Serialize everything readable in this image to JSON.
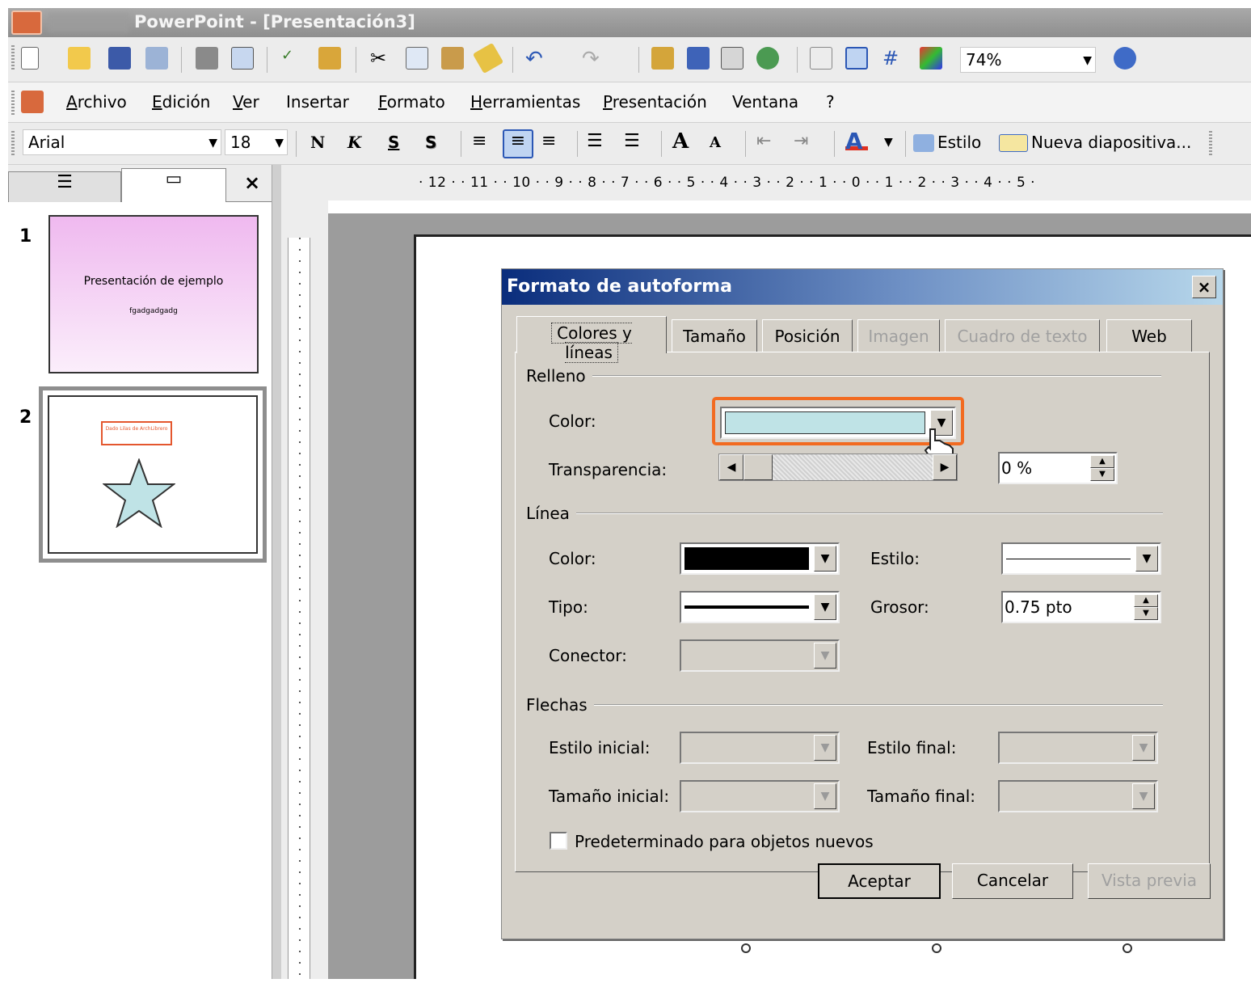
{
  "window": {
    "title": "PowerPoint - [Presentación3]"
  },
  "toolbar": {
    "zoom": "74%",
    "icons": [
      "new-icon",
      "open-icon",
      "save-icon",
      "permission-icon",
      "print-icon",
      "print-preview-icon",
      "spelling-icon",
      "research-icon",
      "cut-icon",
      "copy-icon",
      "paste-icon",
      "format-painter-icon",
      "undo-icon",
      "redo-icon",
      "chart-icon",
      "table-icon",
      "tables-borders-icon",
      "hyperlink-icon",
      "expand-icon",
      "grayscale-icon",
      "grid-icon",
      "color-icon",
      "help-icon"
    ]
  },
  "menu": {
    "items": [
      "Archivo",
      "Edición",
      "Ver",
      "Insertar",
      "Formato",
      "Herramientas",
      "Presentación",
      "Ventana",
      "?"
    ]
  },
  "format_toolbar": {
    "font": "Arial",
    "size": "18",
    "bold": "N",
    "italic": "K",
    "underline": "S",
    "shadow": "S",
    "style_label": "Estilo",
    "new_slide_label": "Nueva diapositiva..."
  },
  "ruler": {
    "horizontal": "· 12 · · 11 · · 10 · · 9 · · 8 · · 7 · · 6 · · 5 · · 4 · · 3 · · 2 · · 1 · · 0 · · 1 · · 2 · · 3 · · 4 · · 5 ·"
  },
  "slides_panel": {
    "close_label": "×",
    "slides": [
      {
        "number": "1",
        "title": "Presentación de ejemplo",
        "subtitle": "fgadgadgadg"
      },
      {
        "number": "2",
        "box_text": "Dado Lilas de ArchLibrero"
      }
    ]
  },
  "dialog": {
    "title": "Formato de autoforma",
    "close": "×",
    "tabs": [
      "Colores y líneas",
      "Tamaño",
      "Posición",
      "Imagen",
      "Cuadro de texto",
      "Web"
    ],
    "relleno": {
      "label": "Relleno",
      "color_label": "Color:",
      "color_value": "#bfe3e6",
      "transparency_label": "Transparencia:",
      "transparency_value": "0 %"
    },
    "linea": {
      "label": "Línea",
      "color_label": "Color:",
      "color_value": "#000000",
      "estilo_label": "Estilo:",
      "tipo_label": "Tipo:",
      "grosor_label": "Grosor:",
      "grosor_value": "0.75 pto",
      "conector_label": "Conector:"
    },
    "flechas": {
      "label": "Flechas",
      "estilo_inicial_label": "Estilo inicial:",
      "estilo_final_label": "Estilo final:",
      "tamano_inicial_label": "Tamaño inicial:",
      "tamano_final_label": "Tamaño final:"
    },
    "checkbox_label": "Predeterminado para objetos nuevos",
    "buttons": {
      "accept": "Aceptar",
      "cancel": "Cancelar",
      "preview": "Vista previa"
    }
  },
  "colors": {
    "highlight": "#f26b21",
    "fill_color": "#bfe3e6",
    "star_fill": "#bfe3e6"
  }
}
